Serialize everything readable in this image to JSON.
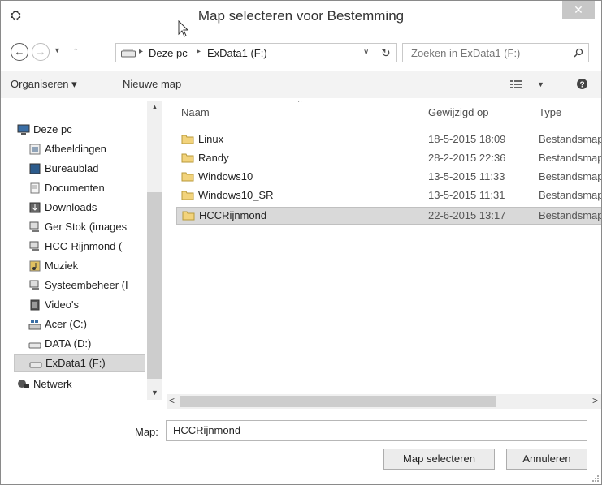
{
  "window": {
    "title": "Map selecteren voor Bestemming",
    "close_label": "✕"
  },
  "nav": {
    "breadcrumb": [
      "Deze pc",
      "ExData1 (F:)"
    ],
    "search_placeholder": "Zoeken in ExData1 (F:)"
  },
  "toolbar": {
    "organize": "Organiseren ▾",
    "new_folder": "Nieuwe map"
  },
  "sidebar": {
    "items": [
      {
        "label": "Deze pc",
        "icon": "computer-icon"
      },
      {
        "label": "Afbeeldingen",
        "icon": "pictures-icon"
      },
      {
        "label": "Bureaublad",
        "icon": "desktop-icon"
      },
      {
        "label": "Documenten",
        "icon": "documents-icon"
      },
      {
        "label": "Downloads",
        "icon": "downloads-icon"
      },
      {
        "label": "Ger Stok (images",
        "icon": "network-share-icon"
      },
      {
        "label": "HCC-Rijnmond (",
        "icon": "network-share-icon"
      },
      {
        "label": "Muziek",
        "icon": "music-icon"
      },
      {
        "label": "Systeembeheer (I",
        "icon": "network-share-icon"
      },
      {
        "label": "Video's",
        "icon": "videos-icon"
      },
      {
        "label": "Acer (C:)",
        "icon": "system-drive-icon"
      },
      {
        "label": "DATA (D:)",
        "icon": "drive-icon"
      },
      {
        "label": "ExData1 (F:)",
        "icon": "drive-icon"
      },
      {
        "label": "Netwerk",
        "icon": "network-icon"
      }
    ]
  },
  "list": {
    "columns": [
      "Naam",
      "Gewijzigd op",
      "Type"
    ],
    "rows": [
      {
        "name": "Linux",
        "date": "18-5-2015 18:09",
        "type": "Bestandsmap"
      },
      {
        "name": "Randy",
        "date": "28-2-2015 22:36",
        "type": "Bestandsmap"
      },
      {
        "name": "Windows10",
        "date": "13-5-2015 11:33",
        "type": "Bestandsmap"
      },
      {
        "name": "Windows10_SR",
        "date": "13-5-2015 11:31",
        "type": "Bestandsmap"
      },
      {
        "name": "HCCRijnmond",
        "date": "22-6-2015 13:17",
        "type": "Bestandsmap"
      }
    ]
  },
  "footer": {
    "map_label": "Map:",
    "map_value": "HCCRijnmond",
    "select_button": "Map selecteren",
    "cancel_button": "Annuleren"
  }
}
